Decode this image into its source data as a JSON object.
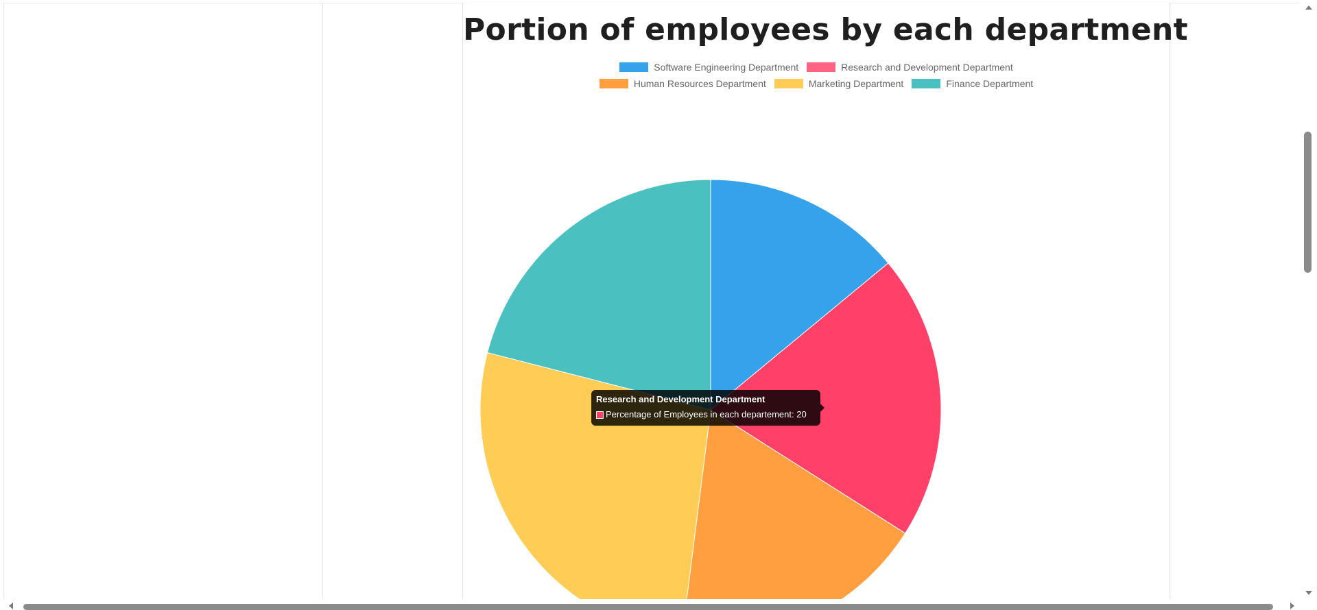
{
  "chart_data": {
    "type": "pie",
    "title": "Portion of employees by each department",
    "categories": [
      "Software Engineering Department",
      "Research and Development Department",
      "Human Resources Department",
      "Marketing Department",
      "Finance Department"
    ],
    "series": [
      {
        "name": "Percentage of Employees in each departement",
        "values": [
          14,
          20,
          18,
          27,
          21
        ]
      }
    ],
    "colors": [
      "#36a2eb",
      "#ff4069",
      "#ff9f40",
      "#ffcd56",
      "#4bc0c0"
    ],
    "legend_position": "top",
    "start_angle_deg": -90,
    "direction": "clockwise"
  },
  "tooltip": {
    "title": "Research and Development Department",
    "label": "Percentage of Employees in each departement: 20",
    "color": "#ff4069"
  }
}
